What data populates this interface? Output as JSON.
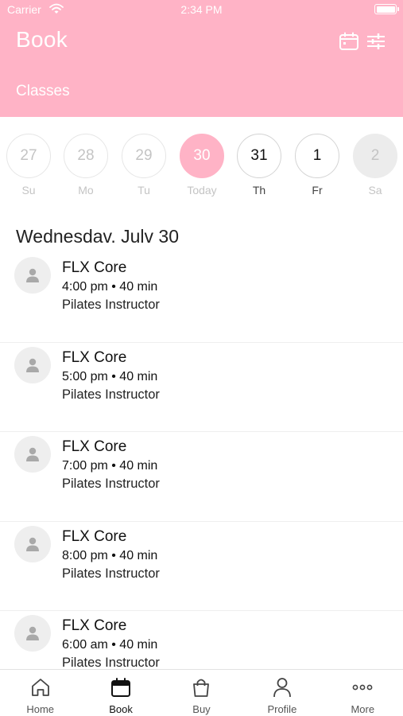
{
  "status_bar": {
    "carrier": "Carrier",
    "time": "2:34 PM"
  },
  "header": {
    "title": "Book",
    "subtitle": "Classes",
    "bg_color": "#ffb3c6"
  },
  "day_strip": [
    {
      "number": "27",
      "label": "Su",
      "state": "past"
    },
    {
      "number": "28",
      "label": "Mo",
      "state": "past"
    },
    {
      "number": "29",
      "label": "Tu",
      "state": "past"
    },
    {
      "number": "30",
      "label": "Today",
      "state": "selected"
    },
    {
      "number": "31",
      "label": "Th",
      "state": "future"
    },
    {
      "number": "1",
      "label": "Fr",
      "state": "future"
    },
    {
      "number": "2",
      "label": "Sa",
      "state": "disabled"
    }
  ],
  "date_heading": "Wednesdav. Julv 30",
  "classes": [
    {
      "name": "FLX Core",
      "time": "4:00 pm • 40 min",
      "instructor": "Pilates Instructor"
    },
    {
      "name": "FLX Core",
      "time": "5:00 pm • 40 min",
      "instructor": "Pilates Instructor"
    },
    {
      "name": "FLX Core",
      "time": "7:00 pm • 40 min",
      "instructor": "Pilates Instructor"
    },
    {
      "name": "FLX Core",
      "time": "8:00 pm • 40 min",
      "instructor": "Pilates Instructor"
    },
    {
      "name": "FLX Core",
      "time": "6:00 am • 40 min",
      "instructor": "Pilates Instructor"
    }
  ],
  "tab_bar": [
    {
      "label": "Home",
      "icon": "home-icon"
    },
    {
      "label": "Book",
      "icon": "calendar-icon",
      "active": true
    },
    {
      "label": "Buy",
      "icon": "shopping-bag-icon"
    },
    {
      "label": "Profile",
      "icon": "person-icon"
    },
    {
      "label": "More",
      "icon": "more-dots-icon"
    }
  ]
}
